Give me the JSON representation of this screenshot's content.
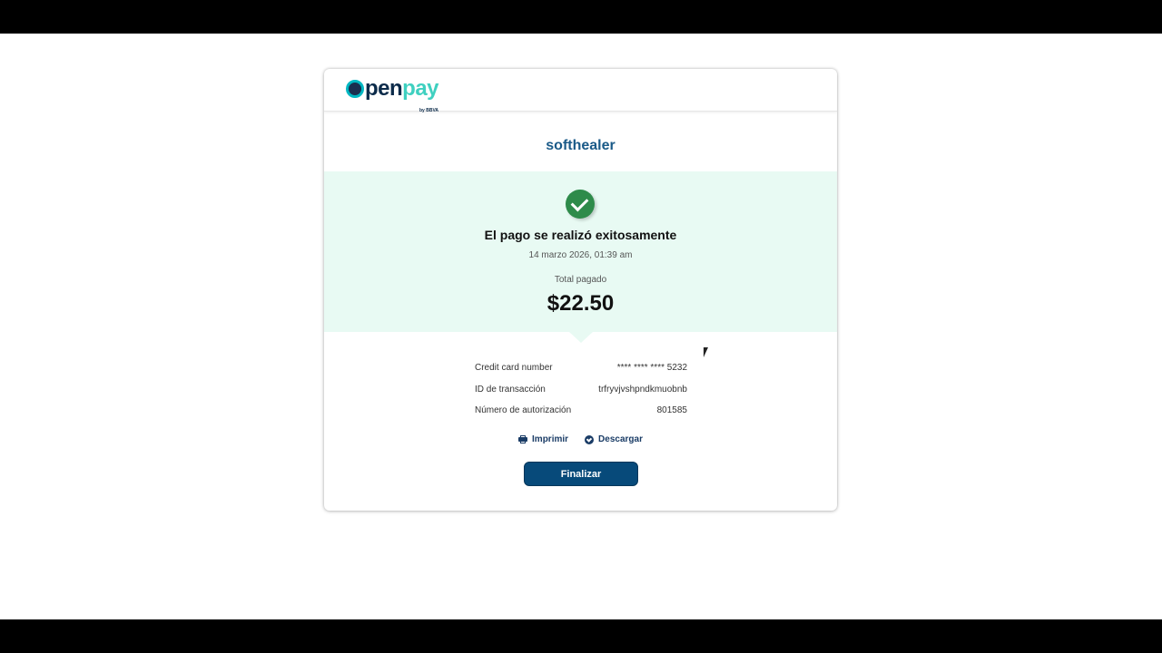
{
  "brand": {
    "open": "pen",
    "pay": "pay",
    "sub": "by BBVA"
  },
  "merchant": "softhealer",
  "success": {
    "icon": "check-circle-icon",
    "title": "El pago se realizó exitosamente",
    "date": "14 marzo 2026, 01:39 am",
    "total_label": "Total pagado",
    "total_amount": "$22.50"
  },
  "details": [
    {
      "label": "Credit card number",
      "value": "**** **** **** 5232"
    },
    {
      "label": "ID de transacción",
      "value": "trfryvjvshpndkmuobnb"
    },
    {
      "label": "Número de autorización",
      "value": "801585"
    }
  ],
  "actions": {
    "print_label": "Imprimir",
    "download_label": "Descargar",
    "finalize_label": "Finalizar"
  },
  "colors": {
    "accent": "#074a7a",
    "success": "#2e8b4a",
    "panel_bg": "#e8faf3",
    "merchant_text": "#1a5a88"
  }
}
